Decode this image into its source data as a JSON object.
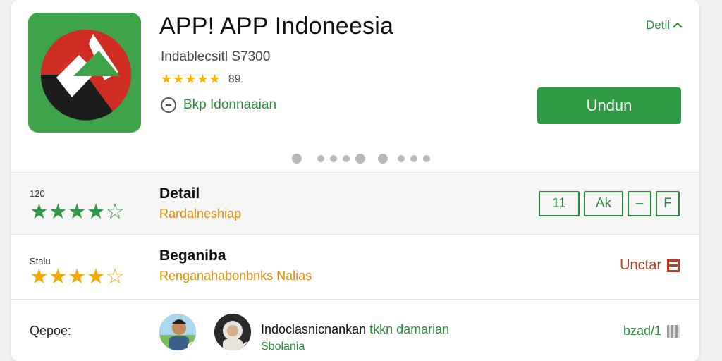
{
  "header": {
    "title": "APP! APP Indoneesia",
    "subtitle": "Indablecsitl S7300",
    "rating_stars": "★★★★★",
    "rating_count": "89",
    "developer": "Bkp Idonnaaian",
    "detail_link": "Detil",
    "install_label": "Undun"
  },
  "section_detail": {
    "small_label": "120",
    "stars": "★★★★☆",
    "title": "Detail",
    "subtitle": "Rardalneshiap",
    "tags": [
      "11",
      "Ak",
      "–",
      "F"
    ]
  },
  "section_rating": {
    "small_label": "Stalu",
    "stars": "★★★★☆",
    "title": "Beganiba",
    "subtitle": "Renganahabonbnks Nalias",
    "report_label": "Unctar"
  },
  "section_review": {
    "label": "Qepoe:",
    "text_main": "Indoclasnicnankan",
    "text_green": "tkkn damarian",
    "sub": "Sbolania",
    "qr_label": "bzad/1"
  },
  "colors": {
    "accent_green": "#2e9a44",
    "star_gold": "#f2b100",
    "report_red": "#c0391e",
    "rating_subtitle": "#e08a00"
  }
}
